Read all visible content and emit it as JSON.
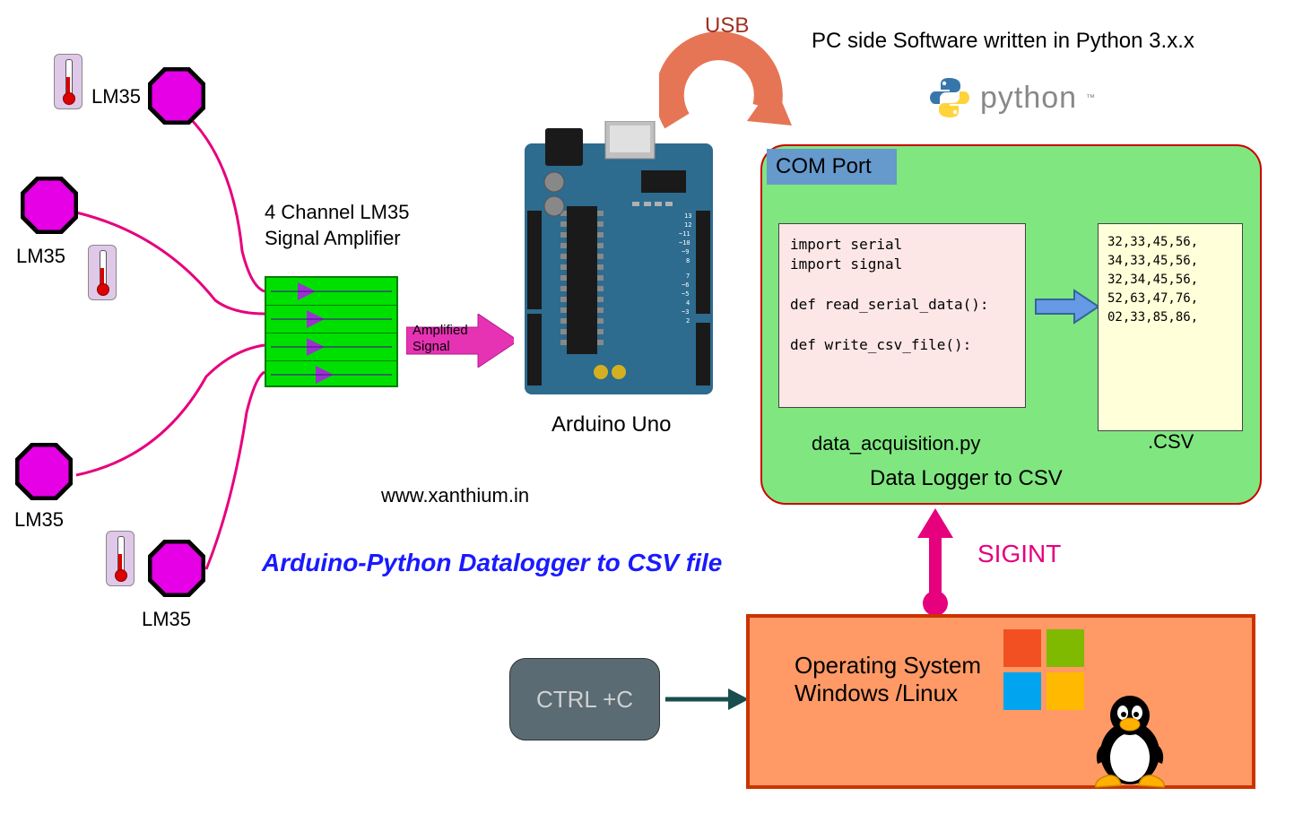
{
  "title": "Arduino-Python Datalogger to CSV file",
  "website": "www.xanthium.in",
  "sensors": {
    "label1": "LM35",
    "label2": "LM35",
    "label3": "LM35",
    "label4": "LM35"
  },
  "amplifier": {
    "label": "4 Channel LM35\nSignal Amplifier",
    "signal_label": "Amplified\nSignal"
  },
  "arduino": {
    "label": "Arduino Uno"
  },
  "usb": {
    "label": "USB"
  },
  "pc": {
    "label": "PC side Software written in Python 3.x.x",
    "python": "python"
  },
  "datalogger": {
    "com_port": "COM Port",
    "code": "import serial\nimport signal\n\ndef read_serial_data():\n\ndef write_csv_file():",
    "script_name": "data_acquisition.py",
    "csv_data": "32,33,45,56,\n34,33,45,56,\n32,34,45,56,\n52,63,47,76,\n02,33,85,86,",
    "csv_label": ".CSV",
    "box_label": "Data Logger to CSV"
  },
  "signals": {
    "sigint": "SIGINT",
    "ctrlc": "CTRL +C"
  },
  "os": {
    "line1": "Operating System",
    "line2": "Windows /Linux"
  }
}
